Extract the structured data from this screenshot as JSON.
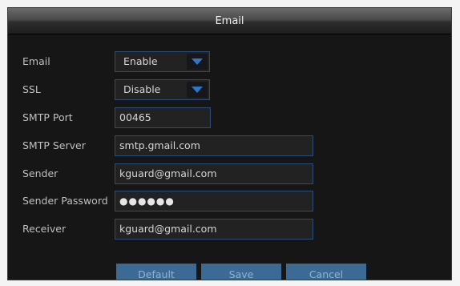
{
  "dialog": {
    "title": "Email"
  },
  "form": {
    "email": {
      "label": "Email",
      "value": "Enable"
    },
    "ssl": {
      "label": "SSL",
      "value": "Disable"
    },
    "smtp_port": {
      "label": "SMTP Port",
      "value": "00465"
    },
    "smtp_server": {
      "label": "SMTP Server",
      "value": "smtp.gmail.com"
    },
    "sender": {
      "label": "Sender",
      "value": "kguard@gmail.com"
    },
    "sender_password": {
      "label": "Sender Password",
      "value": "●●●●●●"
    },
    "receiver": {
      "label": "Receiver",
      "value": "kguard@gmail.com"
    }
  },
  "buttons": {
    "default": "Default",
    "save": "Save",
    "cancel": "Cancel"
  },
  "icons": {
    "dropdown": "chevron-down-icon"
  },
  "colors": {
    "accent": "#3b6b94",
    "field_border": "#2c4d78",
    "arrow": "#2f76c4"
  }
}
